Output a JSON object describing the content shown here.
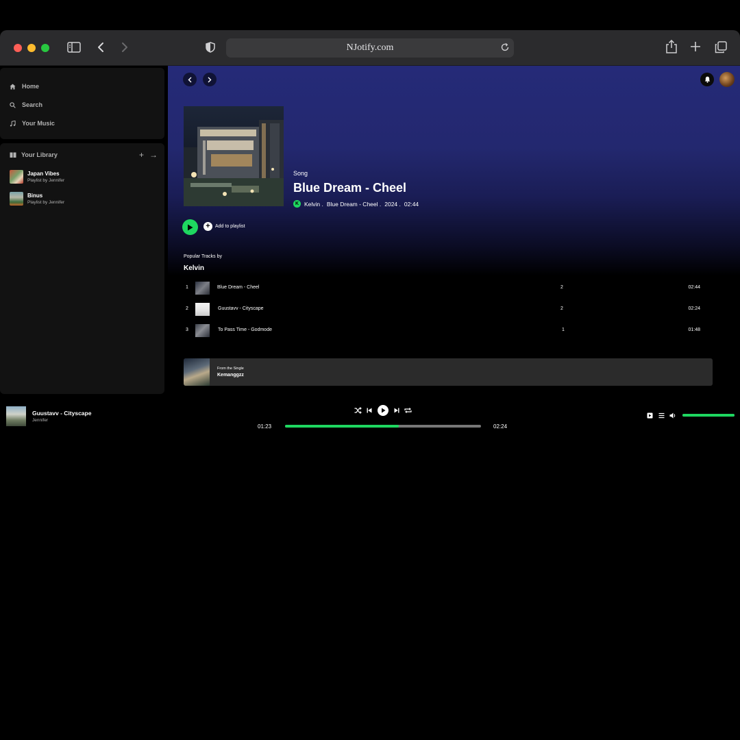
{
  "browser": {
    "url": "NJotify.com"
  },
  "sidebar": {
    "nav": [
      {
        "label": "Home",
        "icon": "home-icon"
      },
      {
        "label": "Search",
        "icon": "search-icon"
      },
      {
        "label": "Your Music",
        "icon": "music-note-icon"
      }
    ],
    "library": {
      "title": "Your Library",
      "items": [
        {
          "title": "Japan Vibes",
          "subtitle": "Playlist by Jennifer"
        },
        {
          "title": "Binus",
          "subtitle": "Playlist by Jennifer"
        }
      ]
    }
  },
  "song": {
    "type_label": "Song",
    "title": "Blue Dream - Cheel",
    "artist_initial": "K",
    "artist": "Kelvin .",
    "album": "Blue Dream - Cheel .",
    "year": "2024 .",
    "duration": "02:44",
    "add_to_playlist": "Add to playlist"
  },
  "popular": {
    "label": "Popular Tracks by",
    "artist": "Kelvin",
    "tracks": [
      {
        "num": "1",
        "name": "Blue Dream - Cheel",
        "plays": "2",
        "duration": "02:44"
      },
      {
        "num": "2",
        "name": "Guustavv - Cityscape",
        "plays": "2",
        "duration": "02:24"
      },
      {
        "num": "3",
        "name": "To Pass Time - Godmode",
        "plays": "1",
        "duration": "01:48"
      }
    ]
  },
  "single": {
    "from_label": "From the Single",
    "name": "Kemanggzz"
  },
  "player": {
    "title": "Guustavv - Cityscape",
    "artist": "Jennifer",
    "elapsed": "01:23",
    "total": "02:24",
    "progress_fraction": 0.58,
    "volume_fraction": 1.0
  },
  "colors": {
    "accent": "#1ed760",
    "header_gradient": "#252a78",
    "panel": "#121212"
  }
}
